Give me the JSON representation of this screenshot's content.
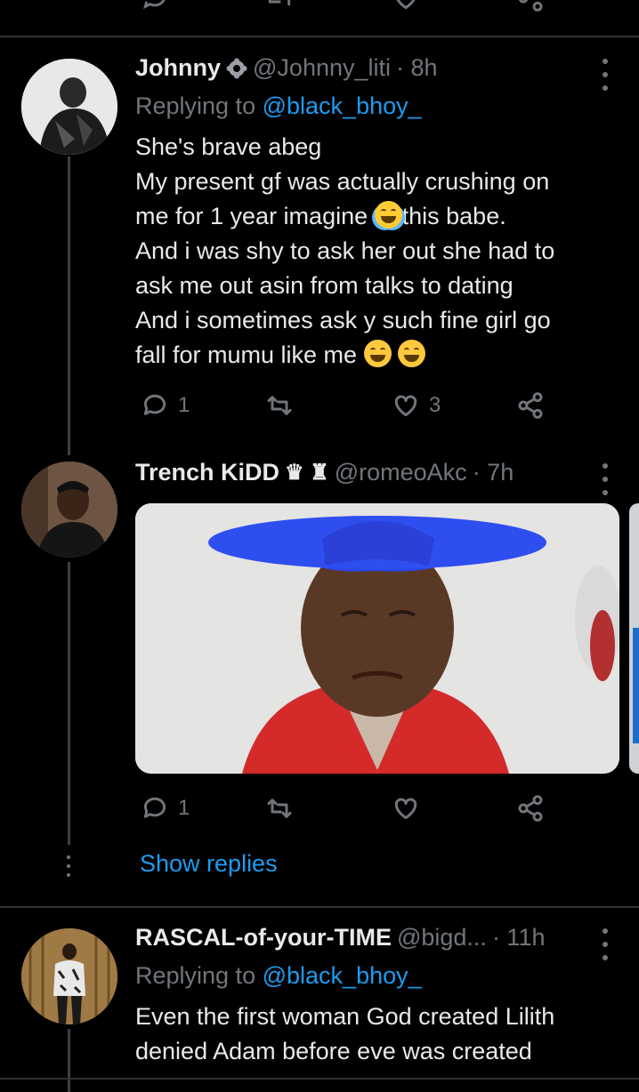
{
  "tweets": [
    {
      "name": "Johnny",
      "handle": "@Johnny_liti",
      "time": "· 8h",
      "replying_prefix": "Replying to",
      "replying_to": "@black_bhoy_",
      "lines": [
        "She's brave abeg",
        "My present gf was actually crushing on",
        "me for 1 year imagine ",
        "this babe.",
        "And i was shy to ask her out she had to",
        "ask me out asin from talks to dating",
        "And i sometimes ask y such fine girl go",
        "fall for mumu like me "
      ],
      "reply_count": "1",
      "retweet_count": "",
      "like_count": "3"
    },
    {
      "name": "Trench KiDD",
      "name_symbols": "♛ ♜",
      "handle": "@romeoAkc",
      "time": "· 7h",
      "reply_count": "1",
      "retweet_count": "",
      "like_count": "",
      "show_replies": "Show replies"
    },
    {
      "name": "RASCAL-of-your-TIME",
      "handle": "@bigd...",
      "time": "· 11h",
      "replying_prefix": "Replying to",
      "replying_to": "@black_bhoy_",
      "lines": [
        "Even the first woman God created Lilith",
        "denied Adam before eve was created"
      ]
    }
  ],
  "icons": {
    "reply": "reply-icon",
    "retweet": "retweet-icon",
    "like": "heart-icon",
    "share": "share-icon",
    "more": "more-icon",
    "verified": "verified-badge-icon"
  },
  "colors": {
    "background": "#000000",
    "text": "#e7e9ea",
    "muted": "#71767b",
    "accent": "#1d9bf0"
  }
}
